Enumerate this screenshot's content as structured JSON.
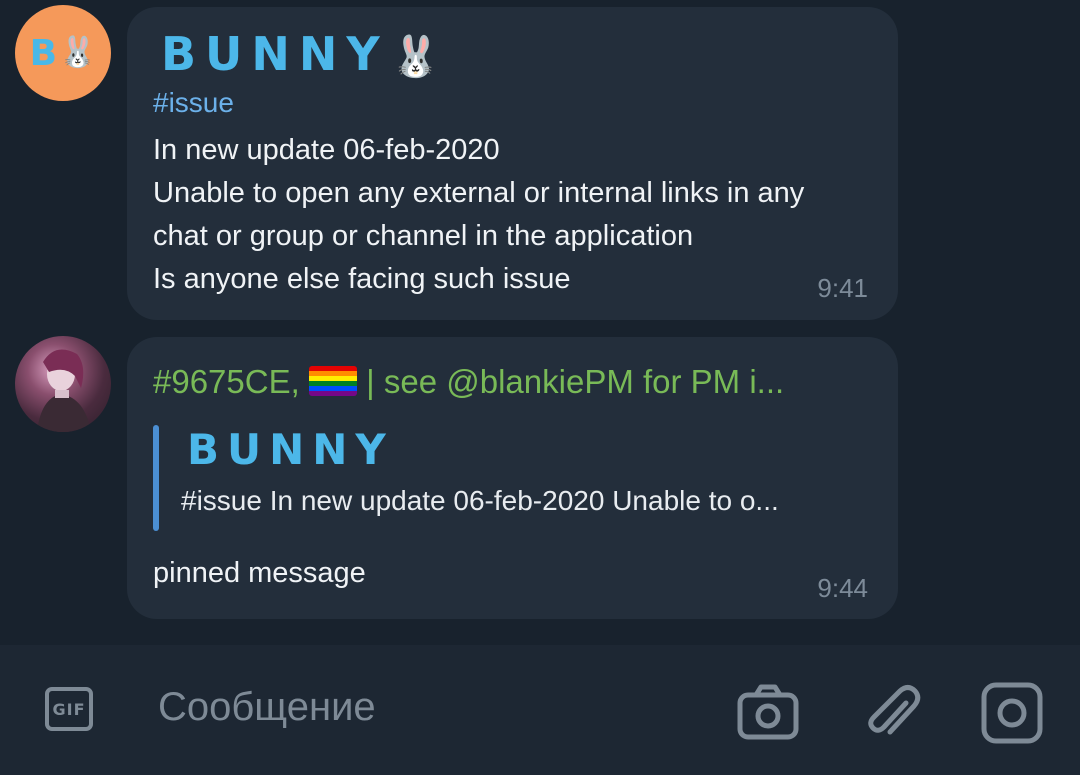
{
  "messages": [
    {
      "avatar": {
        "letter": "B",
        "emoji": "🐰"
      },
      "sender": "BUNNY",
      "sender_emoji": "🐰",
      "hashtag": "#issue",
      "lines": [
        "In new update 06-feb-2020",
        "Unable to open any external or internal links in any",
        "chat or group or channel in the application",
        "Is anyone else facing such issue"
      ],
      "time": "9:41"
    },
    {
      "sender_prefix": "#9675CE,",
      "sender_suffix": "| see @blankiePM for PM i...",
      "reply": {
        "name": "BUNNY",
        "text": "#issue In new update 06-feb-2020 Unable to o..."
      },
      "text": "pinned message",
      "time": "9:44"
    }
  ],
  "composer": {
    "gif_label": "GIF",
    "placeholder": "Сообщение",
    "icons": [
      "gif-icon",
      "camera-icon",
      "paperclip-icon",
      "instant-camera-icon"
    ]
  },
  "colors": {
    "chat_bg": "#18222d",
    "bubble": "#232e3b",
    "bunny_name": "#4cb7e9",
    "user_name": "#79ba57",
    "hashtag": "#6cb1ea",
    "reply_bar": "#4b8fd3",
    "timestamp": "#7d8b99",
    "avatar_bunny_bg": "#f5995a"
  }
}
